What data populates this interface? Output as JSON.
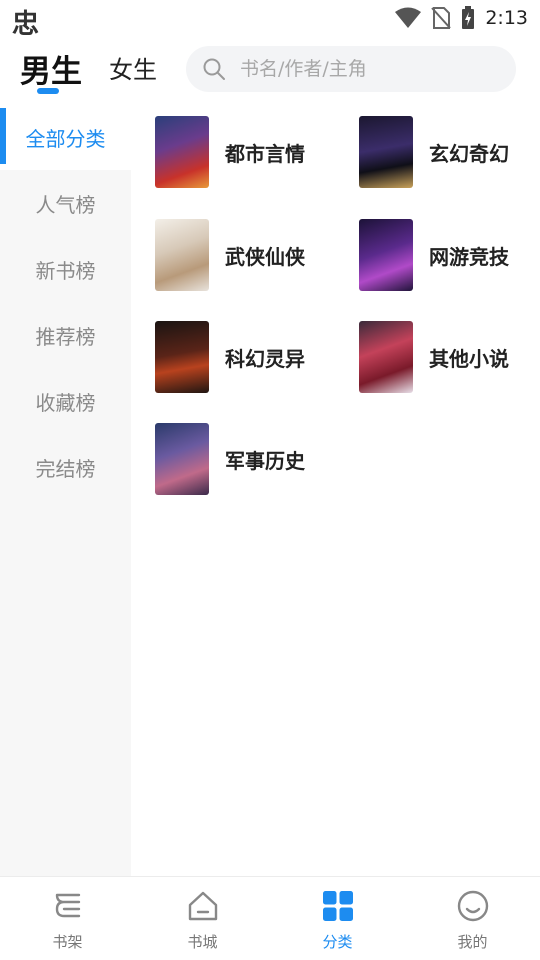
{
  "status_bar": {
    "app_glyph": "忠",
    "time": "2:13"
  },
  "header": {
    "tabs": [
      {
        "label": "男生",
        "active": true
      },
      {
        "label": "女生",
        "active": false
      }
    ],
    "search": {
      "placeholder": "书名/作者/主角"
    }
  },
  "sidebar": {
    "items": [
      {
        "label": "全部分类",
        "active": true
      },
      {
        "label": "人气榜"
      },
      {
        "label": "新书榜"
      },
      {
        "label": "推荐榜"
      },
      {
        "label": "收藏榜"
      },
      {
        "label": "完结榜"
      }
    ]
  },
  "categories": [
    {
      "label": "都市言情"
    },
    {
      "label": "玄幻奇幻"
    },
    {
      "label": "武侠仙侠"
    },
    {
      "label": "网游竞技"
    },
    {
      "label": "科幻灵异"
    },
    {
      "label": "其他小说"
    },
    {
      "label": "军事历史"
    }
  ],
  "bottom_nav": [
    {
      "label": "书架",
      "icon": "bookshelf-icon"
    },
    {
      "label": "书城",
      "icon": "home-icon"
    },
    {
      "label": "分类",
      "icon": "grid-icon",
      "active": true
    },
    {
      "label": "我的",
      "icon": "smile-icon"
    }
  ],
  "colors": {
    "accent": "#1d8cf0",
    "sidebar_bg": "#f7f7f7"
  }
}
